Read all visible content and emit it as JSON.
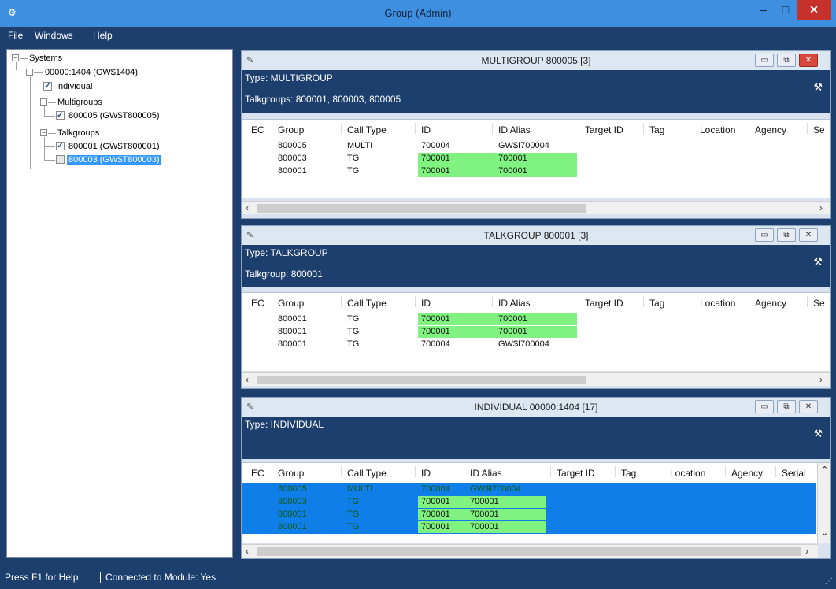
{
  "window": {
    "title": "Group (Admin)",
    "min": "–",
    "max": "□",
    "close": "✕"
  },
  "menu": {
    "file": "File",
    "windows": "Windows",
    "help": "Help"
  },
  "tree": {
    "root": "Systems",
    "system": "00000:1404 (GW$1404)",
    "individual": "Individual",
    "multigroups": "Multigroups",
    "multigroup_item": "800005 (GW$T800005)",
    "talkgroups": "Talkgroups",
    "talkgroup_item_1": "800001 (GW$T800001)",
    "talkgroup_item_2": "800003 (GW$T800003)",
    "checked_mark": "✓"
  },
  "columns": [
    "EC",
    "Group",
    "Call Type",
    "ID",
    "ID Alias",
    "Target ID",
    "Tag",
    "Location",
    "Agency",
    "Se"
  ],
  "columns_individual": [
    "EC",
    "Group",
    "Call Type",
    "ID",
    "ID Alias",
    "Target ID",
    "Tag",
    "Location",
    "Agency",
    "Serial"
  ],
  "windows": {
    "multigroup": {
      "title": "MULTIGROUP 800005 [3]",
      "type": "Type: MULTIGROUP",
      "members": "Talkgroups: 800001, 800003, 800005",
      "rows": [
        {
          "group": "800005",
          "call_type": "MULTI",
          "id": "700004",
          "alias": "GW$I700004",
          "highlight": false
        },
        {
          "group": "800003",
          "call_type": "TG",
          "id": "700001",
          "alias": "700001",
          "highlight": true
        },
        {
          "group": "800001",
          "call_type": "TG",
          "id": "700001",
          "alias": "700001",
          "highlight": true
        }
      ]
    },
    "talkgroup": {
      "title": "TALKGROUP 800001 [3]",
      "type": "Type: TALKGROUP",
      "members": "Talkgroup: 800001",
      "rows": [
        {
          "group": "800001",
          "call_type": "TG",
          "id": "700001",
          "alias": "700001",
          "highlight": true
        },
        {
          "group": "800001",
          "call_type": "TG",
          "id": "700001",
          "alias": "700001",
          "highlight": true
        },
        {
          "group": "800001",
          "call_type": "TG",
          "id": "700004",
          "alias": "GW$I700004",
          "highlight": false
        }
      ]
    },
    "individual": {
      "title": "INDIVIDUAL 00000:1404 [17]",
      "type": "Type: INDIVIDUAL",
      "rows": [
        {
          "group": "800005",
          "call_type": "MULTI",
          "id": "700004",
          "alias": "GW$I700004",
          "highlight": false
        },
        {
          "group": "800003",
          "call_type": "TG",
          "id": "700001",
          "alias": "700001",
          "highlight": true
        },
        {
          "group": "800001",
          "call_type": "TG",
          "id": "700001",
          "alias": "700001",
          "highlight": true
        },
        {
          "group": "800001",
          "call_type": "TG",
          "id": "700001",
          "alias": "700001",
          "highlight": true
        }
      ]
    }
  },
  "status": {
    "help": "Press F1 for Help",
    "connection": "Connected to Module: Yes"
  },
  "colors": {
    "accent": "#1c3f6e",
    "title_bar": "#3e8fe0",
    "highlight": "#7ff27f",
    "selection": "#0f7ee8"
  }
}
